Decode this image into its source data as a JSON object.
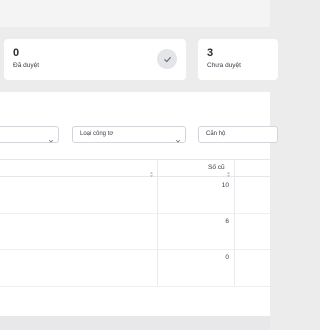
{
  "stats": [
    {
      "value": "0",
      "label": "Đã duyệt",
      "icon": "check-icon"
    },
    {
      "value": "3",
      "label": "Chưa duyệt"
    }
  ],
  "filters": {
    "type_label": "Loại công tơ",
    "apartment_label": "Căn hộ"
  },
  "table": {
    "columns": [
      "",
      "Số cũ"
    ],
    "rows": [
      {
        "old_reading": "10"
      },
      {
        "old_reading": "6"
      },
      {
        "old_reading": "0"
      }
    ]
  },
  "colors": {
    "background": "#ececed",
    "card": "#ffffff",
    "border": "#d3d5da",
    "text": "#2b2d33"
  }
}
